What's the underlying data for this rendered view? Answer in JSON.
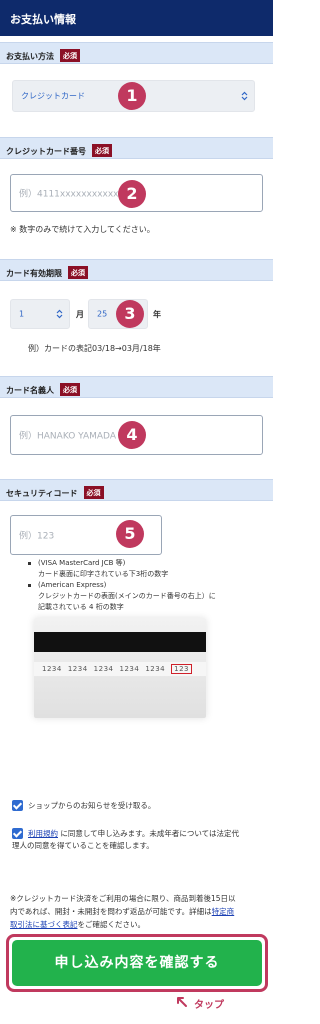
{
  "header": {
    "title": "お支払い情報"
  },
  "required_label": "必須",
  "payment_method": {
    "label": "お支払い方法",
    "selected": "クレジットカード",
    "badge": "1"
  },
  "card_number": {
    "label": "クレジットカード番号",
    "placeholder": "例）4111xxxxxxxxxxx",
    "badge": "2",
    "note": "※ 数字のみで続けて入力してください。"
  },
  "expiry": {
    "label": "カード有効期限",
    "month_value": "1",
    "month_unit": "月",
    "year_value": "25",
    "year_unit": "年",
    "badge": "3",
    "note": "例）カードの表記03/18→03月/18年"
  },
  "card_name": {
    "label": "カード名義人",
    "placeholder": "例）HANAKO YAMADA",
    "badge": "4"
  },
  "security_code": {
    "label": "セキュリティコード",
    "placeholder": "例）123",
    "badge": "5",
    "bullets": [
      "(VISA MasterCard JCB 等)",
      "カード裏面に印字されている下3桁の数字",
      "(American Express)",
      "クレジットカードの表面(メインのカード番号の右上）に",
      "記載されている 4 桁の数字"
    ],
    "card_sig_numbers": [
      "1234",
      "1234",
      "1234",
      "1234",
      "1234"
    ],
    "card_cvv": "123"
  },
  "newsletter": {
    "label": "ショップからのお知らせを受け取る。"
  },
  "terms": {
    "link": "利用規約",
    "line1_rest": " に同意して申し込みます。未成年者については法定代",
    "line2": "理人の同意を得ていることを確認します。"
  },
  "disclaimer": {
    "line1": "※クレジットカード決済をご利用の場合に限り、商品到着後15日以",
    "line2a": "内であれば、開封・未開封を問わず返品が可能です。詳細は",
    "link_a": "特定商",
    "link_b": "取引法に基づく表記",
    "line3_rest": "をご確認ください。"
  },
  "confirm_button": {
    "label": "申し込み内容を確認する"
  },
  "tap_label": "タップ",
  "colors": {
    "header_bg": "#0e2a6b",
    "section_bg": "#dbe7f7",
    "required_bg": "#8b1026",
    "badge_bg": "#c0395e",
    "button_bg": "#22b24c",
    "link": "#1a3fb3"
  }
}
